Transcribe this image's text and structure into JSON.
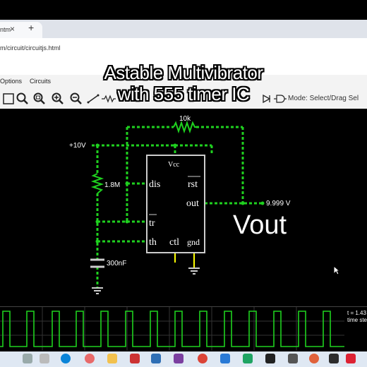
{
  "browser": {
    "tab_title": "ntm",
    "tab_close": "×",
    "new_tab": "+",
    "url": "m/circuit/circuitjs.html"
  },
  "menu": {
    "options": "Options",
    "circuits": "Circuits"
  },
  "toolbar": {
    "mode_label": "Mode: Select/Drag Sel"
  },
  "overlay": {
    "line1": "Astable Multivibrator",
    "line2": "with 555 timer IC"
  },
  "circuit": {
    "supply_label": "+10V",
    "resistor_top": "10k",
    "resistor_left": "1.8M",
    "capacitor": "300nF",
    "chip_vcc": "Vcc",
    "pin_dis": "dis",
    "pin_rst": "rst",
    "pin_out": "out",
    "pin_tr": "tr",
    "pin_th": "th",
    "pin_ctl": "ctl",
    "pin_gnd": "gnd",
    "output_voltage": "9.999 V",
    "vout_label": "Vout"
  },
  "scope": {
    "time_line1": "t = 1.43",
    "time_line2": "time ste"
  },
  "colors": {
    "wire": "#1fd11f",
    "component": "#cccccc",
    "canvas": "#000000",
    "node": "#ffff00"
  }
}
